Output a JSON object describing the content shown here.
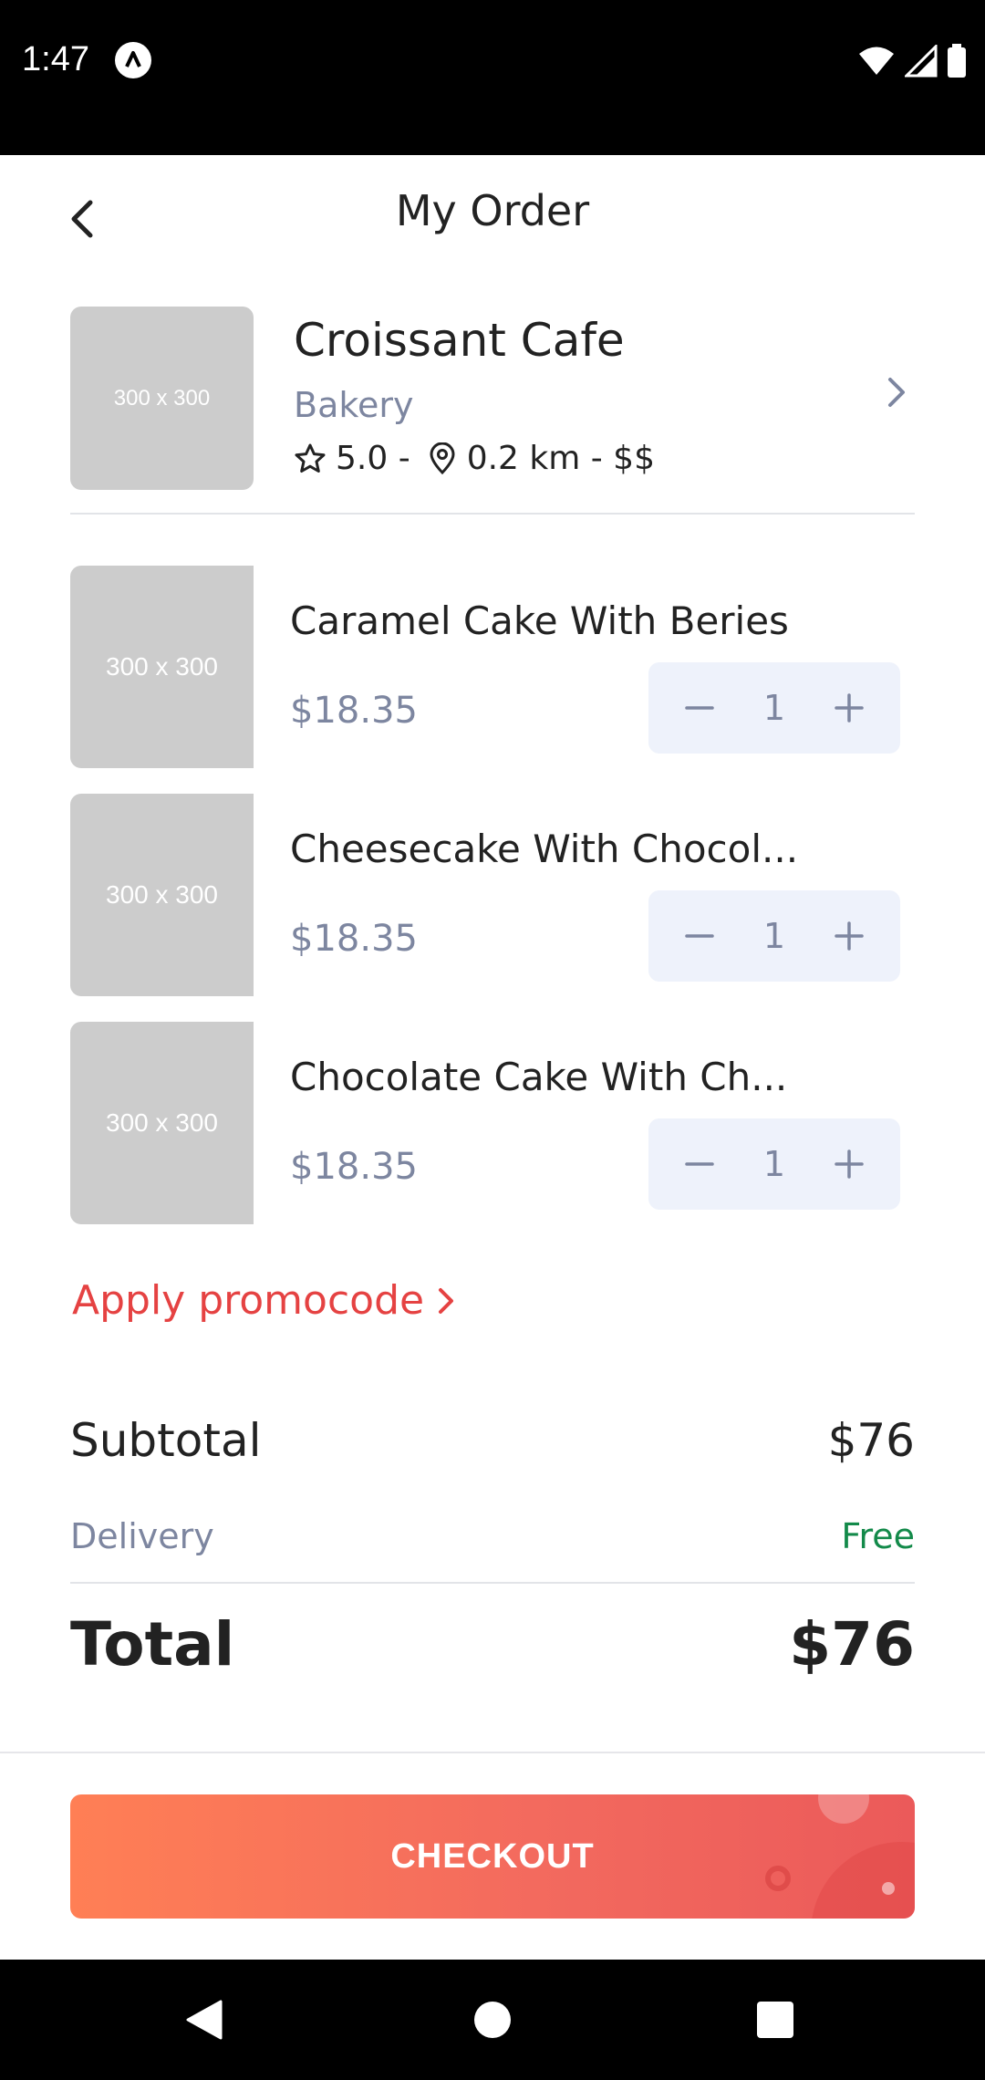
{
  "status_bar": {
    "time": "1:47"
  },
  "header": {
    "title": "My Order",
    "back_icon": "chevron-left-icon"
  },
  "restaurant": {
    "thumbnail_label": "300 x 300",
    "name": "Croissant Cafe",
    "category": "Bakery",
    "rating": "5.0 -",
    "distance": "0.2 km - $$"
  },
  "items": [
    {
      "thumbnail_label": "300 x 300",
      "name": "Caramel Cake With Beries",
      "price": "$18.35",
      "quantity": "1"
    },
    {
      "thumbnail_label": "300 x 300",
      "name": "Cheesecake With Chocol...",
      "price": "$18.35",
      "quantity": "1"
    },
    {
      "thumbnail_label": "300 x 300",
      "name": "Chocolate Cake With Ch...",
      "price": "$18.35",
      "quantity": "1"
    }
  ],
  "promo": {
    "label": "Apply promocode"
  },
  "summary": {
    "subtotal_label": "Subtotal",
    "subtotal_value": "$76",
    "delivery_label": "Delivery",
    "delivery_value": "Free",
    "total_label": "Total",
    "total_value": "$76"
  },
  "checkout": {
    "label": "CHECKOUT"
  },
  "colors": {
    "accent": "#e54242",
    "checkout_start": "#ff7f55",
    "checkout_end": "#eb5a5a",
    "free_green": "#138a4a",
    "muted_text": "#7d86a0",
    "stepper_bg": "#eef2fb"
  }
}
